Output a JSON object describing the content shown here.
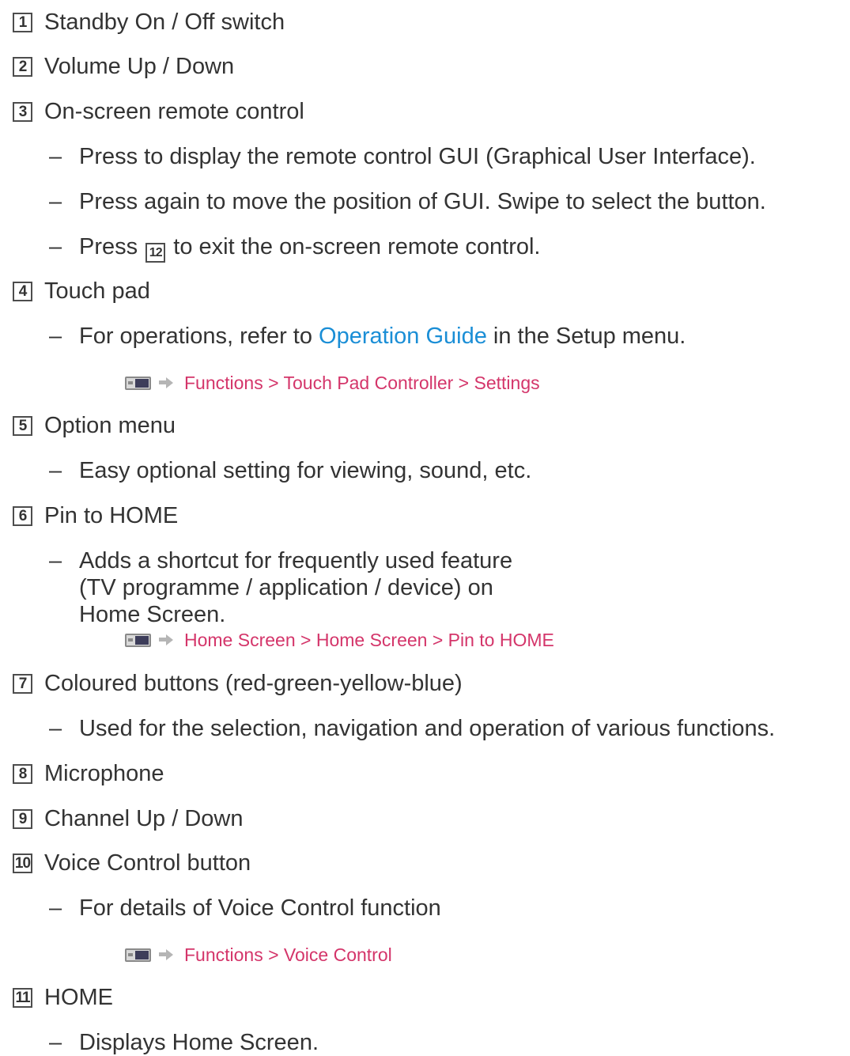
{
  "items": [
    {
      "num": "1",
      "label": "Standby On / Off switch"
    },
    {
      "num": "2",
      "label": "Volume Up / Down"
    },
    {
      "num": "3",
      "label": "On-screen remote control",
      "bullets": [
        "Press to display the remote control GUI (Graphical User Interface).",
        "Press again to move the position of GUI. Swipe to select the button.",
        {
          "before": "Press",
          "num": "12",
          "after": "to exit the on-screen remote control."
        }
      ]
    },
    {
      "num": "4",
      "label": "Touch pad",
      "bullets": [
        {
          "before": "For operations, refer to",
          "link": "Operation Guide",
          "after": "in the Setup menu."
        }
      ],
      "nav": "Functions > Touch Pad Controller > Settings"
    },
    {
      "num": "5",
      "label": "Option menu",
      "bullets": [
        "Easy optional setting for viewing, sound, etc."
      ]
    },
    {
      "num": "6",
      "label": "Pin to HOME",
      "bullets": [
        "Adds a shortcut for frequently used feature (TV programme / application / device) on Home Screen."
      ],
      "nav": "Home Screen > Home Screen > Pin to HOME"
    },
    {
      "num": "7",
      "label": "Coloured buttons (red-green-yellow-blue)",
      "bullets": [
        "Used for the selection, navigation and operation of various functions."
      ]
    },
    {
      "num": "8",
      "label": "Microphone"
    },
    {
      "num": "9",
      "label": "Channel Up / Down"
    },
    {
      "num": "10",
      "label": "Voice Control button",
      "bullets": [
        "For details of Voice Control function"
      ],
      "nav": "Functions > Voice Control"
    },
    {
      "num": "11",
      "label": "HOME",
      "bullets": [
        "Displays Home Screen."
      ]
    }
  ],
  "dash": "–",
  "icons": {
    "menu": "tv-menu-icon",
    "arrow": "arrow-right-icon"
  },
  "colors": {
    "text": "#333333",
    "link": "#1a8ed6",
    "nav": "#d4356a"
  }
}
